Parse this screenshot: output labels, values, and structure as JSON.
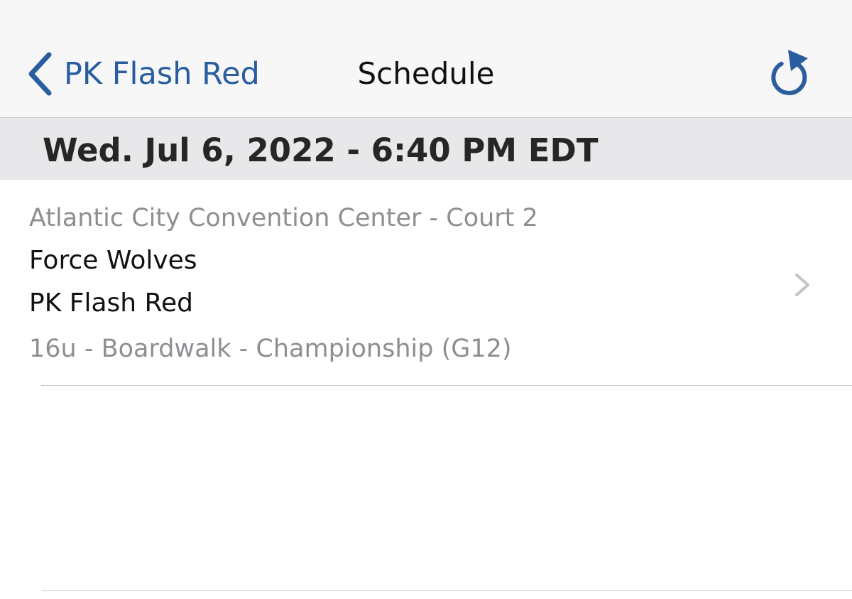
{
  "navbar": {
    "back_label": "PK Flash Red",
    "title": "Schedule",
    "accent_color": "#2a5d9f",
    "back_icon": "chevron-left-icon",
    "refresh_icon": "refresh-icon"
  },
  "section": {
    "header": "Wed. Jul 6, 2022 - 6:40 PM EDT"
  },
  "game": {
    "venue": "Atlantic City Convention Center - Court 2",
    "team_1": "Force Wolves",
    "team_2": "PK Flash Red",
    "division": "16u - Boardwalk - Championship (G12)",
    "disclosure_icon": "chevron-right-icon"
  }
}
